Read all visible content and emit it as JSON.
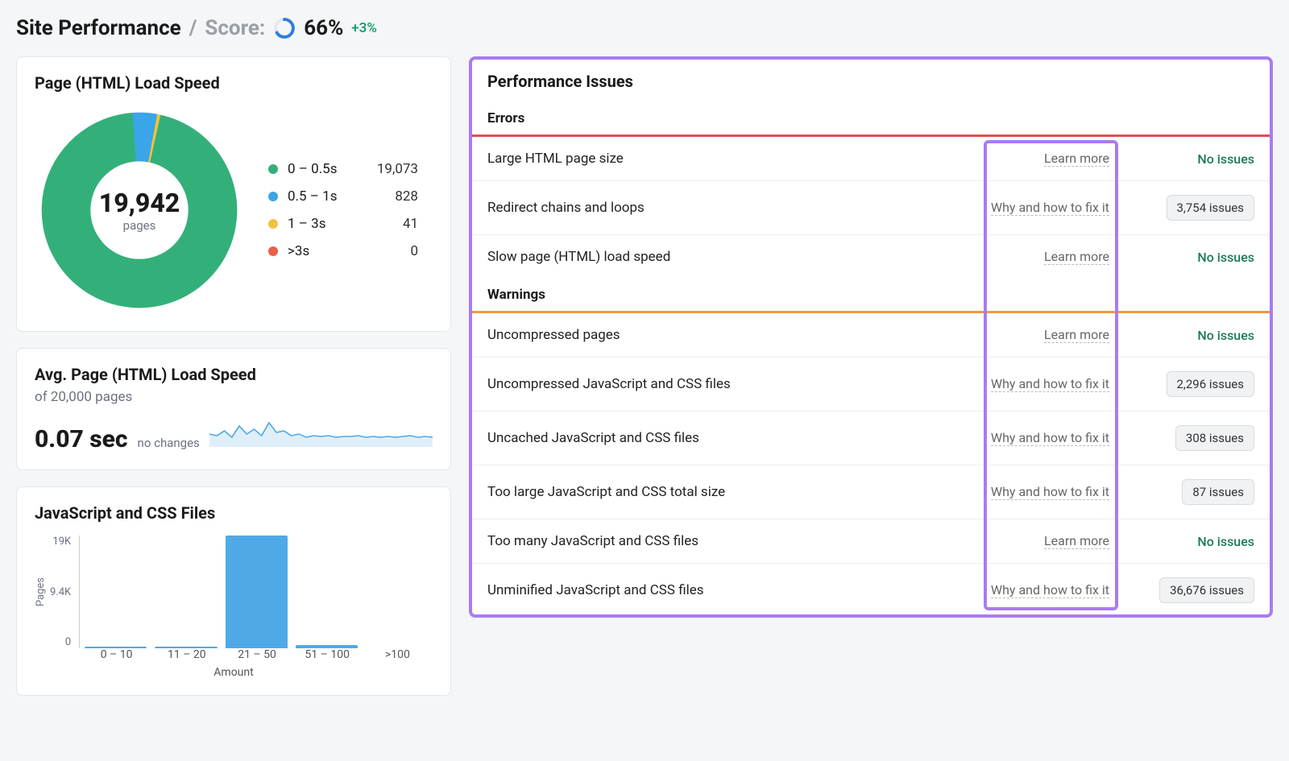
{
  "header": {
    "title": "Site Performance",
    "score_label": "Score:",
    "score_value": "66%",
    "delta": "+3%",
    "ring_color": "#2f7fdc",
    "ring_track": "#e6e8ec"
  },
  "load_speed_card": {
    "title": "Page (HTML) Load Speed",
    "total": "19,942",
    "pages_label": "pages",
    "legend": [
      {
        "label": "0 – 0.5s",
        "value": "19,073",
        "color": "#33b07a"
      },
      {
        "label": "0.5 – 1s",
        "value": "828",
        "color": "#3aa5e8"
      },
      {
        "label": "1 – 3s",
        "value": "41",
        "color": "#f0c23f"
      },
      {
        "label": ">3s",
        "value": "0",
        "color": "#e95f4a"
      }
    ]
  },
  "avg_card": {
    "title": "Avg. Page (HTML) Load Speed",
    "subtitle": "of 20,000 pages",
    "value": "0.07 sec",
    "change": "no changes"
  },
  "jscss_card": {
    "title": "JavaScript and CSS Files",
    "y_label": "Pages",
    "x_label": "Amount",
    "y_ticks": [
      "19K",
      "9.4K",
      "0"
    ],
    "x_ticks": [
      "0 – 10",
      "11 – 20",
      "21 – 50",
      "51 – 100",
      ">100"
    ]
  },
  "issues_card": {
    "title": "Performance Issues",
    "errors_label": "Errors",
    "warnings_label": "Warnings",
    "no_issues_label": "No issues",
    "learn_more_label": "Learn more",
    "fixit_label": "Why and how to fix it",
    "errors": [
      {
        "name": "Large HTML page size",
        "link_type": "learn",
        "status": "none"
      },
      {
        "name": "Redirect chains and loops",
        "link_type": "fix",
        "status": "3,754 issues"
      },
      {
        "name": "Slow page (HTML) load speed",
        "link_type": "learn",
        "status": "none"
      }
    ],
    "warnings": [
      {
        "name": "Uncompressed pages",
        "link_type": "learn",
        "status": "none"
      },
      {
        "name": "Uncompressed JavaScript and CSS files",
        "link_type": "fix",
        "status": "2,296 issues"
      },
      {
        "name": "Uncached JavaScript and CSS files",
        "link_type": "fix",
        "status": "308 issues"
      },
      {
        "name": "Too large JavaScript and CSS total size",
        "link_type": "fix",
        "status": "87 issues"
      },
      {
        "name": "Too many JavaScript and CSS files",
        "link_type": "learn",
        "status": "none"
      },
      {
        "name": "Unminified JavaScript and CSS files",
        "link_type": "fix",
        "status": "36,676 issues"
      }
    ]
  },
  "chart_data": [
    {
      "type": "pie",
      "title": "Page (HTML) Load Speed",
      "categories": [
        "0 – 0.5s",
        "0.5 – 1s",
        "1 – 3s",
        ">3s"
      ],
      "values": [
        19073,
        828,
        41,
        0
      ],
      "total": 19942,
      "colors": [
        "#33b07a",
        "#3aa5e8",
        "#f0c23f",
        "#e95f4a"
      ]
    },
    {
      "type": "bar",
      "title": "JavaScript and CSS Files",
      "xlabel": "Amount",
      "ylabel": "Pages",
      "categories": [
        "0 – 10",
        "11 – 20",
        "21 – 50",
        "51 – 100",
        ">100"
      ],
      "values": [
        200,
        200,
        19000,
        500,
        0
      ],
      "ylim": [
        0,
        19000
      ]
    },
    {
      "type": "line",
      "title": "Avg. Page (HTML) Load Speed sparkline",
      "x": [
        0,
        1,
        2,
        3,
        4,
        5,
        6,
        7,
        8,
        9,
        10,
        11,
        12,
        13,
        14,
        15,
        16,
        17,
        18,
        19,
        20,
        21,
        22,
        23,
        24,
        25,
        26,
        27,
        28,
        29
      ],
      "values": [
        0.08,
        0.07,
        0.09,
        0.06,
        0.11,
        0.07,
        0.1,
        0.07,
        0.13,
        0.08,
        0.09,
        0.07,
        0.08,
        0.06,
        0.07,
        0.07,
        0.08,
        0.07,
        0.06,
        0.07,
        0.07,
        0.08,
        0.07,
        0.06,
        0.07,
        0.07,
        0.07,
        0.08,
        0.07,
        0.07
      ],
      "ylim": [
        0,
        0.15
      ]
    }
  ]
}
